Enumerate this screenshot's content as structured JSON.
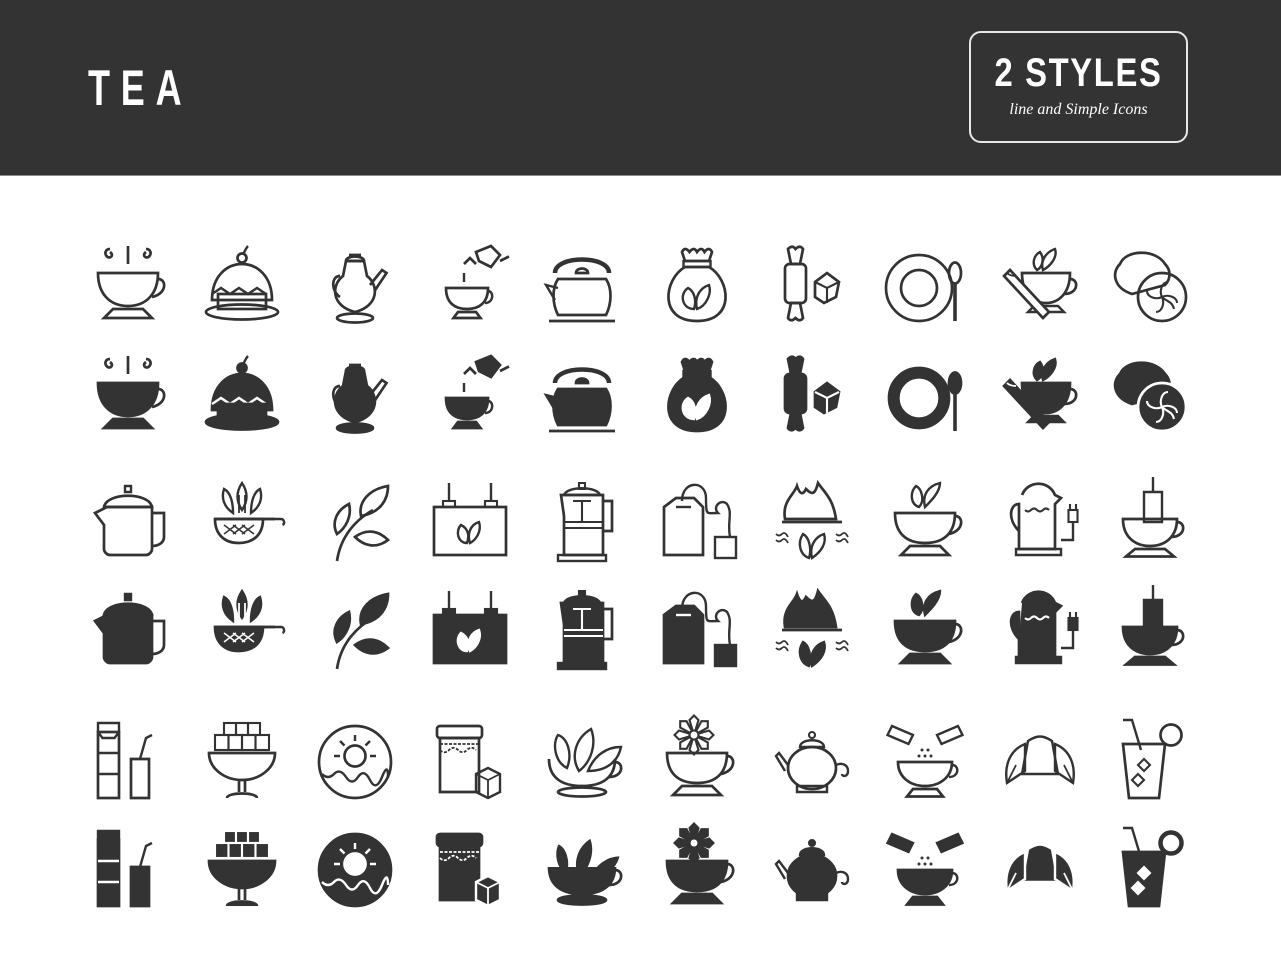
{
  "header": {
    "title": "TEA",
    "badge_main": "2 STYLES",
    "badge_sub": "line and Simple Icons",
    "background_color": "#333333",
    "text_color": "#ffffff"
  },
  "icon_color": "#333333",
  "icon_sets": [
    {
      "set": 1,
      "names": [
        "steaming-teacup",
        "cupcake-cherry",
        "tall-teapot",
        "pouring-tea",
        "kettle",
        "tea-sack",
        "candy-and-sugar-cube",
        "plate-and-spoon",
        "cinnamon-tea-cup",
        "lemon-slice"
      ]
    },
    {
      "set": 2,
      "names": [
        "squat-teapot",
        "tea-strainer-leaves",
        "tea-branch",
        "tea-sign",
        "french-press",
        "tea-bags",
        "fire-leaves",
        "leaf-teacup",
        "electric-kettle",
        "teabag-in-cup"
      ]
    },
    {
      "set": 3,
      "names": [
        "milk-carton-and-glass",
        "sugar-cube-bowl",
        "donut",
        "jam-jar-sugar",
        "leaves-in-cup",
        "flower-teacup",
        "round-teapot",
        "sugar-sachets-cup",
        "croissant",
        "iced-lemon-drink"
      ]
    }
  ],
  "styles": [
    "line",
    "solid"
  ]
}
